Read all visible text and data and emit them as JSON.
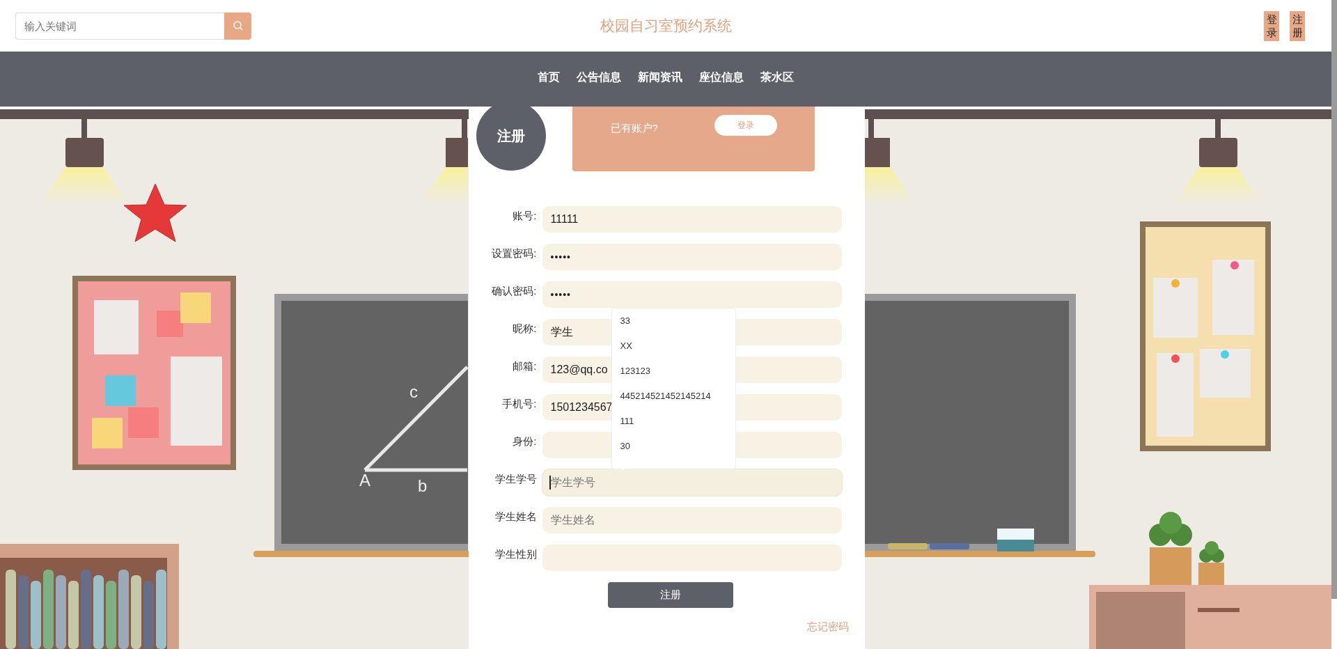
{
  "header": {
    "search": {
      "placeholder": "输入关键词"
    },
    "site_title": "校园自习室预约系统",
    "auth_links": [
      "登录",
      "注册"
    ]
  },
  "nav": [
    {
      "label": "首页"
    },
    {
      "label": "公告信息"
    },
    {
      "label": "新闻资讯"
    },
    {
      "label": "座位信息"
    },
    {
      "label": "茶水区"
    }
  ],
  "scene": {
    "chalk_labels": [
      "c",
      "A",
      "b"
    ]
  },
  "register_card": {
    "badge": "注册",
    "login_prompt": {
      "text": "已有账户?",
      "button": "登录"
    },
    "fields": [
      {
        "label": "账号:",
        "kind": "text",
        "value": "11111",
        "focused": false
      },
      {
        "label": "设置密码:",
        "kind": "password",
        "value": "•••••",
        "focused": false
      },
      {
        "label": "确认密码:",
        "kind": "password",
        "value": "•••••",
        "focused": false
      },
      {
        "label": "昵称:",
        "kind": "text",
        "value": "学生",
        "focused": false
      },
      {
        "label": "邮箱:",
        "kind": "text",
        "value": "123@qq.co",
        "focused": false
      },
      {
        "label": "手机号:",
        "kind": "text",
        "value": "1501234567",
        "focused": false
      },
      {
        "label": "身份:",
        "kind": "text",
        "focused": false
      },
      {
        "label": "学生学号",
        "kind": "text",
        "placeholder": "学生学号",
        "focused": true
      },
      {
        "label": "学生姓名",
        "kind": "text",
        "placeholder": "学生姓名",
        "focused": false
      },
      {
        "label": "学生性别",
        "kind": "text",
        "focused": false
      }
    ],
    "autocomplete": {
      "items": [
        "33",
        "XX",
        "123123",
        "445214521452145214",
        "111",
        "30"
      ]
    },
    "submit": "注册",
    "forgot_link": "忘记密码"
  }
}
